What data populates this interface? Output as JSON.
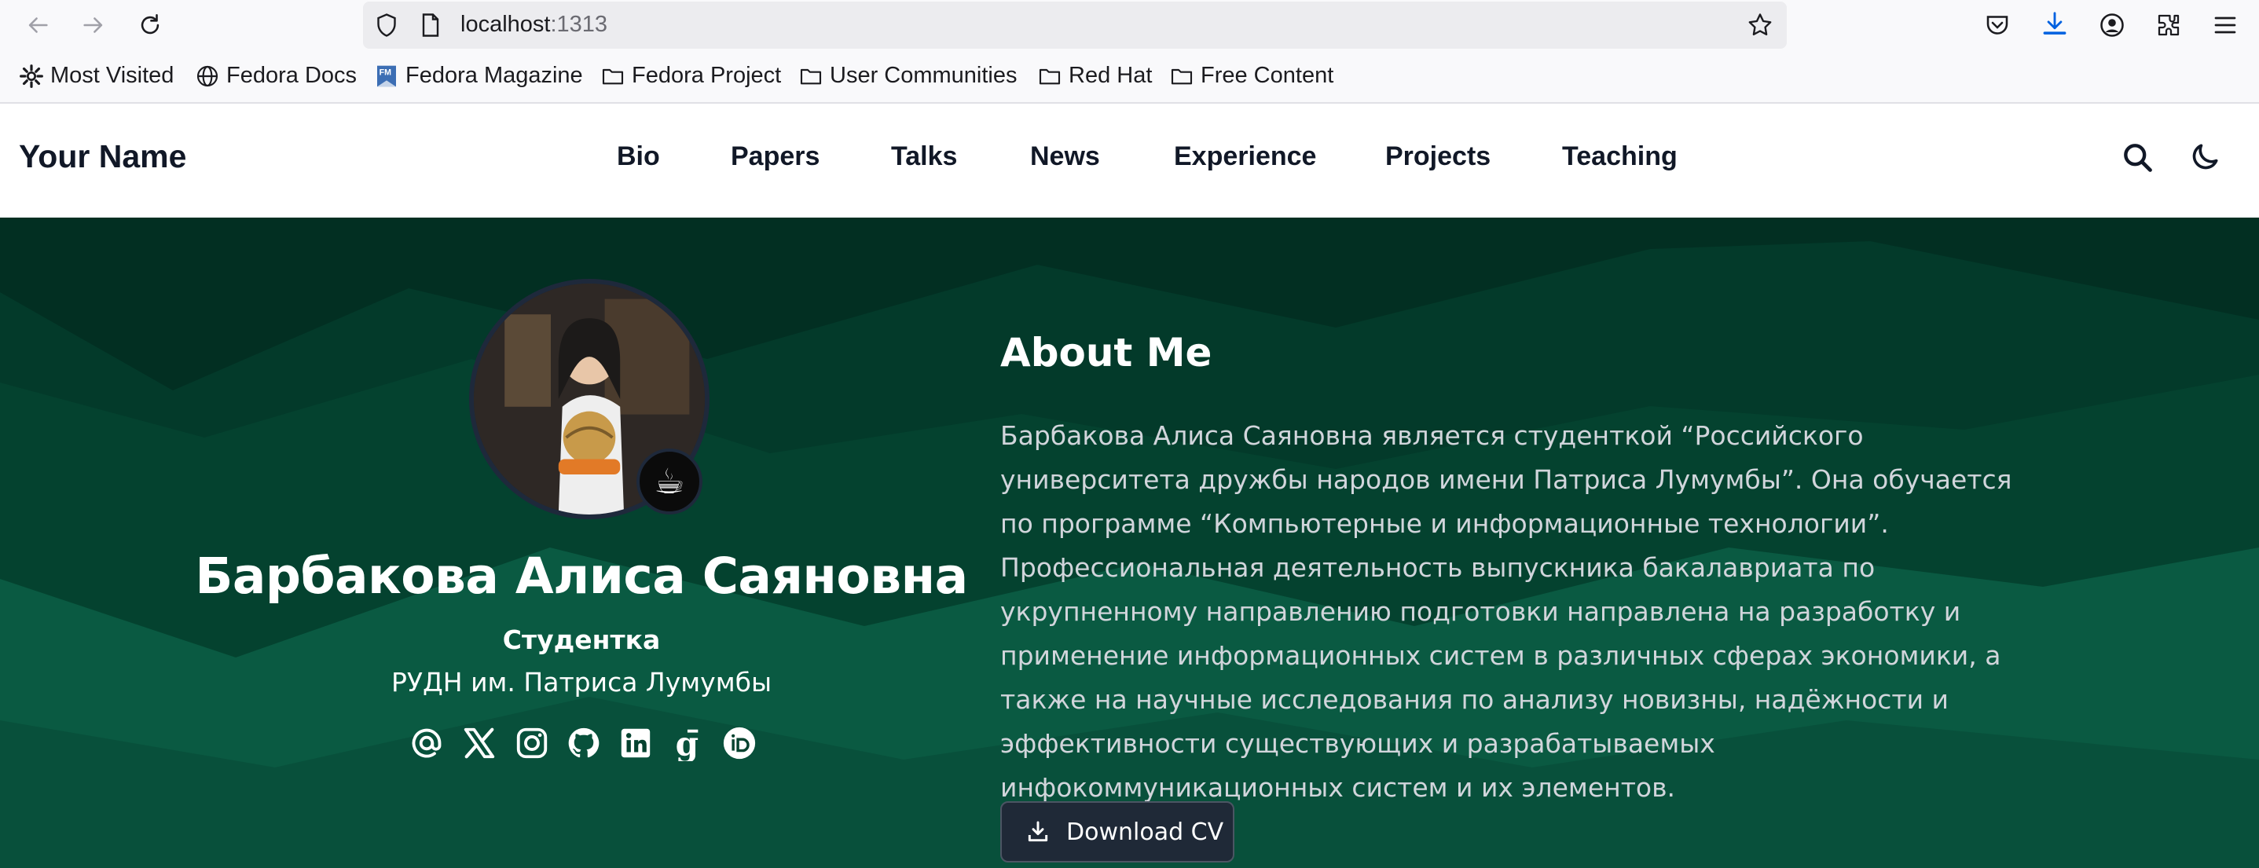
{
  "browser": {
    "url_host": "localhost",
    "url_port": ":1313",
    "bookmarks": [
      {
        "label": "Most Visited",
        "icon": "gear-icon"
      },
      {
        "label": "Fedora Docs",
        "icon": "globe-icon"
      },
      {
        "label": "Fedora Magazine",
        "icon": "fedora-magazine-icon"
      },
      {
        "label": "Fedora Project",
        "icon": "folder-icon"
      },
      {
        "label": "User Communities",
        "icon": "folder-icon"
      },
      {
        "label": "Red Hat",
        "icon": "folder-icon"
      },
      {
        "label": "Free Content",
        "icon": "folder-icon"
      }
    ]
  },
  "site": {
    "brand": "Your Name",
    "nav": [
      "Bio",
      "Papers",
      "Talks",
      "News",
      "Experience",
      "Projects",
      "Teaching"
    ]
  },
  "profile": {
    "name": "Барбакова Алиса Саяновна",
    "role": "Студентка",
    "organization": "РУДН им. Патриса Лумумбы",
    "status_emoji": "☕",
    "socials": [
      "email-icon",
      "x-twitter-icon",
      "instagram-icon",
      "github-icon",
      "linkedin-icon",
      "google-scholar-icon",
      "orcid-icon"
    ]
  },
  "about": {
    "title": "About Me",
    "text": "Барбакова Алиса Саяновна является студенткой “Российского университета дружбы народов имени Патриса Лумумбы”. Она обучается по программе “Компьютерные и информационные технологии”. Профессиональная деятельность выпускника бакалавриата по укрупненному направлению подготовки направлена на разработку и применение информационных систем в различных сферах экономики, а также на научные исследования по анализу новизны, надёжности и эффективности существующих и разрабатываемых инфокоммуникационных систем и их элементов.",
    "cv_label": "Download CV"
  },
  "colors": {
    "hero_bg": "#022f22",
    "hero_layer": "#0b5a42",
    "button_bg": "#1f2937"
  }
}
